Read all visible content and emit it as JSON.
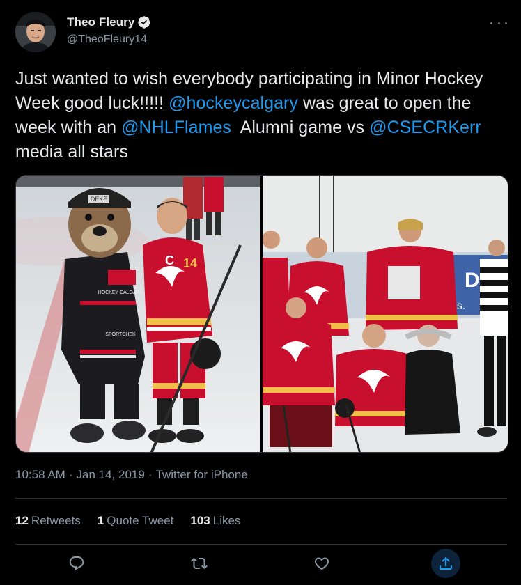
{
  "author": {
    "display_name": "Theo Fleury",
    "handle": "@TheoFleury14",
    "verified": true
  },
  "tweet": {
    "segments": [
      {
        "type": "text",
        "text": "Just wanted to wish everybody participating in Minor Hockey Week good luck!!!!! "
      },
      {
        "type": "mention",
        "text": "@hockeycalgary"
      },
      {
        "type": "text",
        "text": " was great to open the week with an "
      },
      {
        "type": "mention",
        "text": "@NHLFlames"
      },
      {
        "type": "text",
        "text": "  Alumni game vs "
      },
      {
        "type": "mention",
        "text": "@CSECRKerr"
      },
      {
        "type": "text",
        "text": " media all stars"
      }
    ]
  },
  "media": {
    "left_photo_text": {
      "helmet_tag": "DEKE",
      "jersey_sponsor_1": "HOCKEY CALGARY",
      "jersey_sponsor_2": "SPORTCHEK",
      "jersey_number": "14",
      "captain_letter": "C"
    },
    "right_photo_text": {
      "banner_text": "DO",
      "banner_text_2": "ces."
    }
  },
  "meta": {
    "time": "10:58 AM",
    "separator": "·",
    "date": "Jan 14, 2019",
    "source": "Twitter for iPhone"
  },
  "stats": {
    "retweets_count": "12",
    "retweets_label": "Retweets",
    "quotes_count": "1",
    "quotes_label": "Quote Tweet",
    "likes_count": "103",
    "likes_label": "Likes"
  },
  "colors": {
    "background": "#000000",
    "link": "#1d9bf0",
    "secondary_text": "#8b98a5",
    "flames_red": "#c8102e",
    "flames_gold": "#f1be48"
  },
  "icons": [
    "verified-badge-icon",
    "more-icon",
    "reply-icon",
    "retweet-icon",
    "like-icon",
    "share-icon"
  ]
}
